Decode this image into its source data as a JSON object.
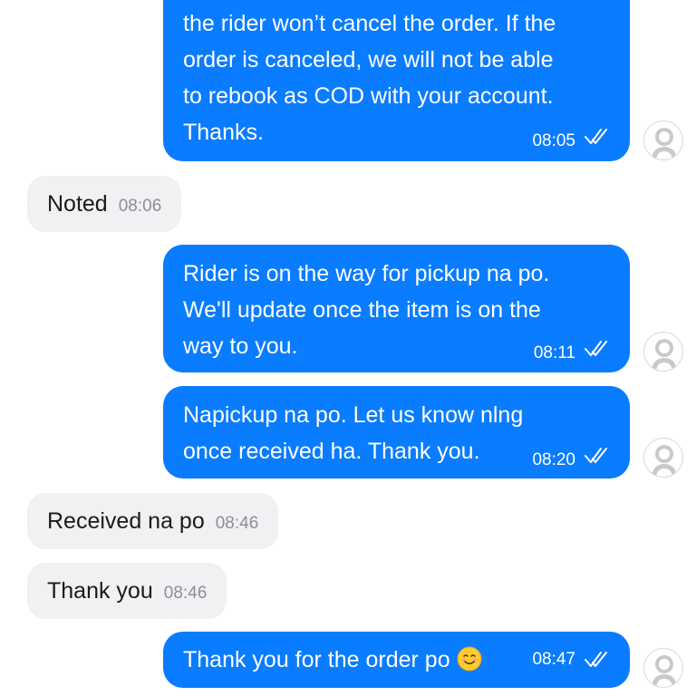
{
  "messages": [
    {
      "direction": "outgoing",
      "lines": [
        "the rider won’t cancel the order. If the",
        "order is canceled, we will not be able",
        "to rebook as COD with your account.",
        "Thanks."
      ],
      "time": "08:05"
    },
    {
      "direction": "incoming",
      "text": "Noted",
      "time": "08:06"
    },
    {
      "direction": "outgoing",
      "lines": [
        "Rider is on the way for pickup na po.",
        "We'll update once the item is on the",
        "way to you."
      ],
      "time": "08:11"
    },
    {
      "direction": "outgoing",
      "lines": [
        "Napickup na po. Let us know nlng",
        "once received ha. Thank you."
      ],
      "time": "08:20"
    },
    {
      "direction": "incoming",
      "text": "Received na po",
      "time": "08:46"
    },
    {
      "direction": "incoming",
      "text": "Thank you",
      "time": "08:46"
    },
    {
      "direction": "outgoing",
      "text": "Thank you for the order po",
      "emoji": "☺",
      "time": "08:47"
    }
  ],
  "colors": {
    "outgoing_bubble": "#0a7cff",
    "incoming_bubble": "#f1f1f3",
    "timestamp_incoming": "#8d8f94"
  },
  "icons": {
    "read_receipt": "double-check-icon",
    "avatar": "default-user-avatar-icon"
  }
}
